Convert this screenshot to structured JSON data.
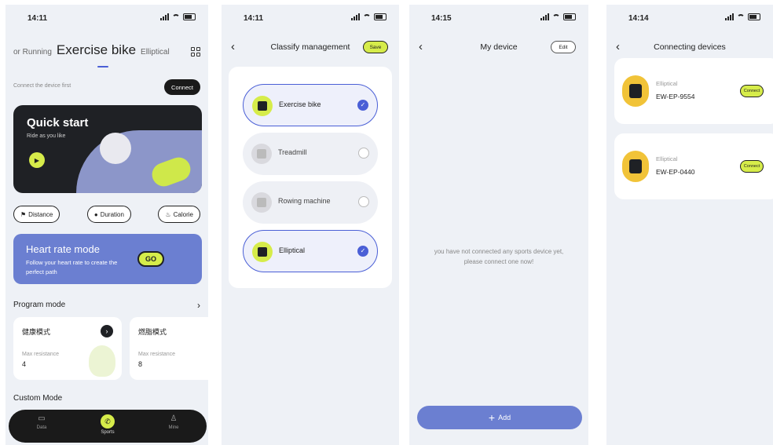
{
  "screen1": {
    "time": "14:11",
    "tabs": {
      "left": "or Running",
      "main": "Exercise bike",
      "right": "Elliptical"
    },
    "connect_hint": "Connect the device first",
    "connect_label": "Connect",
    "quick_start": {
      "title": "Quick start",
      "subtitle": "Ride as you like"
    },
    "chips": [
      {
        "label": "Distance",
        "icon": "flag-icon"
      },
      {
        "label": "Duration",
        "icon": "timer-icon"
      },
      {
        "label": "Calorie",
        "icon": "flame-icon"
      }
    ],
    "heart_rate": {
      "title": "Heart rate mode",
      "subtitle": "Follow your heart rate to create the perfect path",
      "go_label": "GO"
    },
    "program_header": "Program mode",
    "programs": [
      {
        "title": "健康模式",
        "res_label": "Max resistance",
        "value": "4"
      },
      {
        "title": "燃脂模式",
        "res_label": "Max resistance",
        "value": "8"
      }
    ],
    "custom_header": "Custom Mode",
    "nav": [
      {
        "label": "Data"
      },
      {
        "label": "Sports"
      },
      {
        "label": "Mine"
      }
    ]
  },
  "screen2": {
    "time": "14:11",
    "title": "Classify management",
    "save_label": "Save",
    "items": [
      {
        "label": "Exercise bike",
        "selected": true
      },
      {
        "label": "Treadmill",
        "selected": false
      },
      {
        "label": "Rowing machine",
        "selected": false
      },
      {
        "label": "Elliptical",
        "selected": true
      }
    ]
  },
  "screen3": {
    "time": "14:15",
    "title": "My device",
    "edit_label": "Edit",
    "empty_text": "you have not connected any sports device yet, please connect one now!",
    "add_label": "Add"
  },
  "screen4": {
    "time": "14:14",
    "title": "Connecting devices",
    "devices": [
      {
        "type": "Elliptical",
        "code": "EW-EP-9554",
        "btn": "Connect"
      },
      {
        "type": "Elliptical",
        "code": "EW-EP-0440",
        "btn": "Connect"
      }
    ]
  },
  "colors": {
    "accent": "#d6ec4a",
    "primary": "#6b7fd1",
    "dark": "#1f2125"
  }
}
